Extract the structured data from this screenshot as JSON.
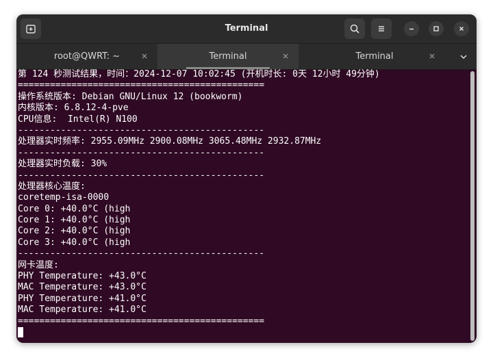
{
  "window": {
    "title": "Terminal"
  },
  "tabs": [
    {
      "label": "root@QWRT: ~",
      "active": false
    },
    {
      "label": "Terminal",
      "active": true
    },
    {
      "label": "Terminal",
      "active": false
    }
  ],
  "icons": {
    "new_tab": "new-tab-icon",
    "search": "search-icon",
    "menu": "hamburger-menu-icon",
    "minimize": "minimize-icon",
    "maximize": "maximize-icon",
    "close": "close-icon",
    "tab_close": "close-icon",
    "tab_dropdown": "chevron-down-icon"
  },
  "colors": {
    "terminal_bg": "#300a24",
    "terminal_fg": "#ffffff",
    "titlebar_bg": "#2b2b2b"
  },
  "terminal": {
    "lines": [
      "第 124 秒测试结果，时间：2024-12-07 10:02:45 (开机时长: 0天 12小时 49分钟)",
      "==============================================",
      "操作系统版本: Debian GNU/Linux 12 (bookworm)",
      "内核版本: 6.8.12-4-pve",
      "CPU信息:  Intel(R) N100",
      "----------------------------------------------",
      "处理器实时频率: 2955.09MHz 2900.08MHz 3065.48MHz 2932.87MHz",
      "----------------------------------------------",
      "处理器实时负载: 30%",
      "----------------------------------------------",
      "处理器核心温度:",
      "coretemp-isa-0000",
      "Core 0: +40.0°C (high",
      "Core 1: +40.0°C (high",
      "Core 2: +40.0°C (high",
      "Core 3: +40.0°C (high",
      "----------------------------------------------",
      "网卡温度:",
      "PHY Temperature: +43.0°C",
      "MAC Temperature: +43.0°C",
      "PHY Temperature: +41.0°C",
      "MAC Temperature: +41.0°C",
      "=============================================="
    ]
  }
}
